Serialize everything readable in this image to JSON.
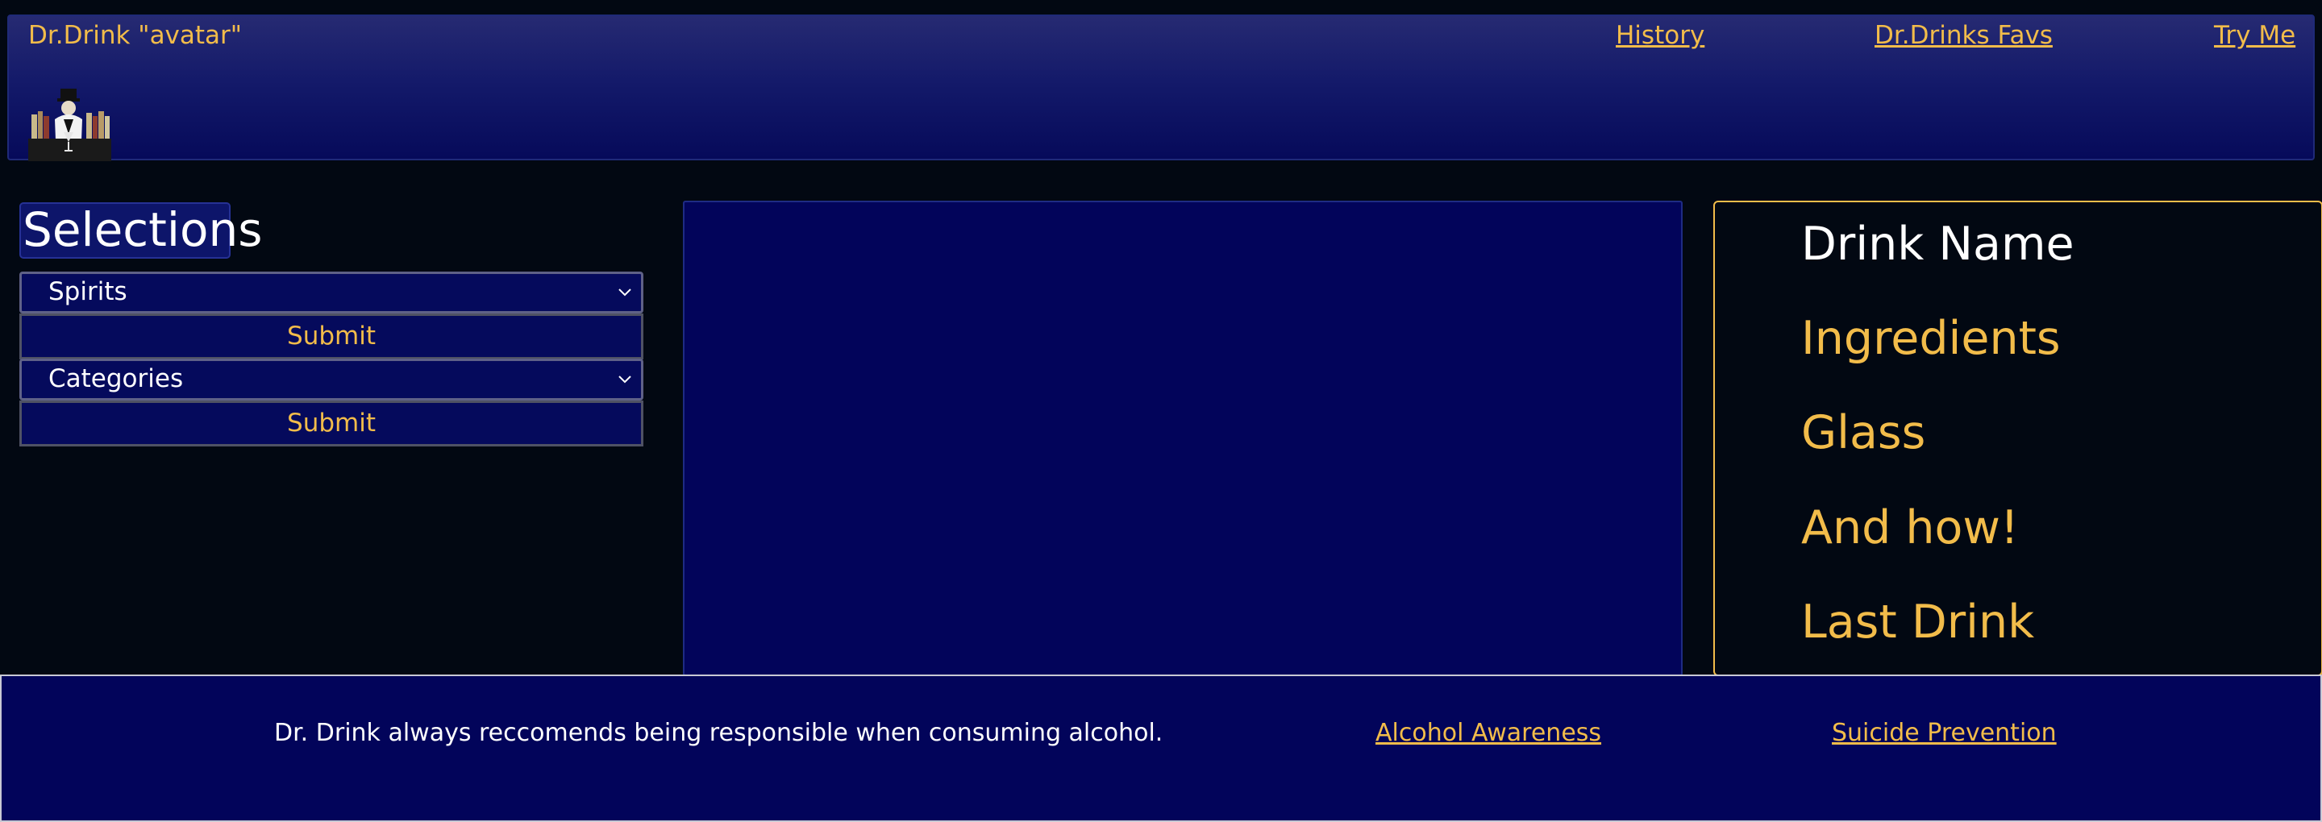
{
  "header": {
    "brand": "Dr.Drink \"avatar\"",
    "nav": {
      "history": "History",
      "favs": "Dr.Drinks Favs",
      "try_me": "Try Me"
    }
  },
  "selections": {
    "title": "Selections",
    "spirits_select": "Spirits",
    "submit_1": "Submit",
    "categories_select": "Categories",
    "submit_2": "Submit"
  },
  "info_panel": {
    "drink_name": "Drink Name",
    "ingredients": "Ingredients",
    "glass": "Glass",
    "and_how": "And how!",
    "last_drink": "Last Drink"
  },
  "footer": {
    "message": "Dr. Drink always reccomends being responsible when consuming alcohol.",
    "link_alcohol": "Alcohol Awareness",
    "link_suicide": "Suicide Prevention"
  },
  "colors": {
    "accent_gold": "#f2bc4a",
    "navy": "#02045a",
    "background": "#020812"
  },
  "icons": [
    "bartender-avatar-icon",
    "chevron-down-icon"
  ]
}
